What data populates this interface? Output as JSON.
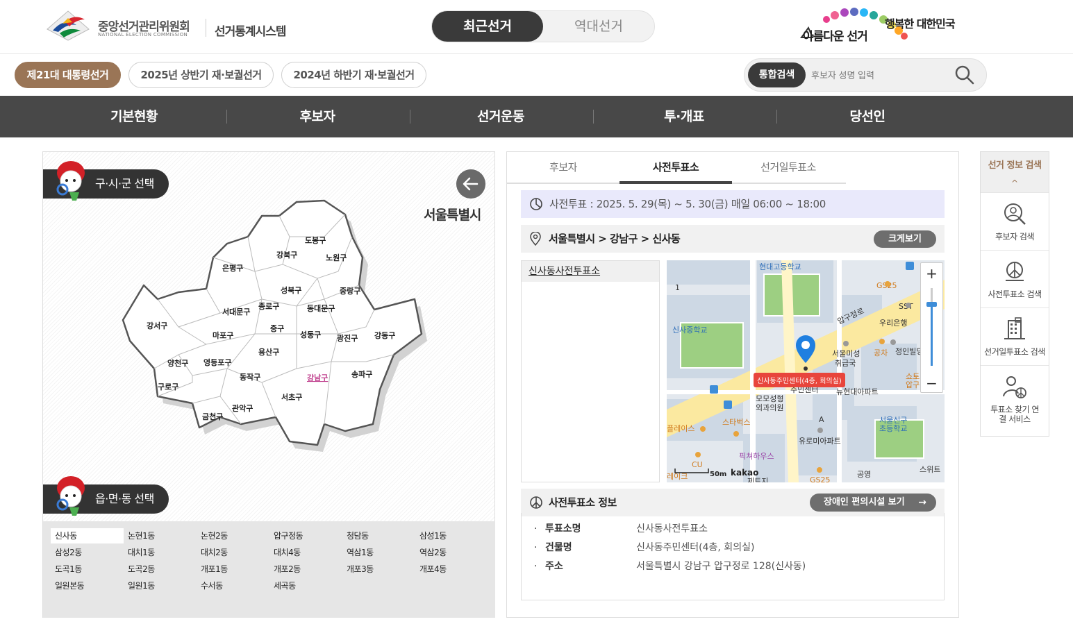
{
  "header": {
    "org_name": "중앙선거관리위원회",
    "org_name_en": "NATIONAL ELECTION COMMISSION",
    "system_name": "선거통계시스템",
    "era_tabs": [
      "최근선거",
      "역대선거"
    ],
    "slogan_line1": "아름다운 선거",
    "slogan_line2": "행복한 대한민국"
  },
  "election_tabs": [
    "제21대 대통령선거",
    "2025년 상반기 재·보궐선거",
    "2024년 하반기 재·보궐선거"
  ],
  "search": {
    "label": "통합검색",
    "placeholder": "후보자 성명 입력"
  },
  "nav": [
    "기본현황",
    "후보자",
    "선거운동",
    "투·개표",
    "당선인"
  ],
  "left": {
    "district_section": "구·시·군 선택",
    "city": "서울특별시",
    "districts": [
      "도봉구",
      "강북구",
      "노원구",
      "은평구",
      "성북구",
      "중랑구",
      "종로구",
      "동대문구",
      "서대문구",
      "강서구",
      "중구",
      "마포구",
      "성동구",
      "광진구",
      "강동구",
      "용산구",
      "양천구",
      "영등포구",
      "강남구",
      "송파구",
      "동작구",
      "구로구",
      "서초구",
      "관악구",
      "금천구"
    ],
    "selected_district": "강남구",
    "dong_section": "읍·면·동 선택",
    "dongs": [
      "신사동",
      "논현1동",
      "논현2동",
      "압구정동",
      "청담동",
      "삼성1동",
      "삼성2동",
      "대치1동",
      "대치2동",
      "대치4동",
      "역삼1동",
      "역삼2동",
      "도곡1동",
      "도곡2동",
      "개포1동",
      "개포2동",
      "개포3동",
      "개포4동",
      "일원본동",
      "일원1동",
      "수서동",
      "세곡동"
    ],
    "selected_dong": "신사동"
  },
  "right": {
    "tabs": [
      "후보자",
      "사전투표소",
      "선거일투표소"
    ],
    "active_tab": "사전투표소",
    "period": "사전투표 : 2025. 5. 29(목) ~ 5. 30(금) 매일 06:00 ~ 18:00",
    "location": "서울특별시 > 강남구 > 신사동",
    "enlarge_label": "크게보기",
    "poll_list": [
      "신사동사전투표소"
    ],
    "map": {
      "marker_label": "신사동주민센터(4층, 회의실)",
      "scale": "50m",
      "provider": "kakao",
      "zoom_in": "+",
      "zoom_out": "−",
      "labels": [
        "현대고등학교",
        "GS25",
        "SST",
        "압구정로",
        "우리은행",
        "신사중학교",
        "서울미성",
        "취급국",
        "공차",
        "정인빌딩",
        "쇼토",
        "압구",
        "뉴현대아파트",
        "모모성형",
        "외과의원",
        "스타벅스",
        "플레이스",
        "유로미아파트",
        "서울신구",
        "초등학교",
        "픽쳐하우스",
        "CU",
        "공영",
        "스위트",
        "제트지",
        "GS25",
        "1",
        "A",
        "주민센터",
        "레이크"
      ]
    },
    "facility_title": "사전투표소 정보",
    "access_label": "장애인 편의시설 보기",
    "facility": [
      {
        "key": "투표소명",
        "value": "신사동사전투표소"
      },
      {
        "key": "건물명",
        "value": "신사동주민센터(4층, 회의실)"
      },
      {
        "key": "주소",
        "value": "서울특별시 강남구 압구정로 128(신사동)"
      }
    ]
  },
  "quick_menu": {
    "title": "선거 정보 검색",
    "up_icon": "^",
    "items": [
      "후보자 검색",
      "사전투표소 검색",
      "선거일투표소 검색",
      "투표소 찾기 연결 서비스"
    ]
  },
  "colors": {
    "accent": "#9a7556",
    "nav_bg": "#484848",
    "dark": "#333333",
    "link_pink": "#c0408e"
  }
}
